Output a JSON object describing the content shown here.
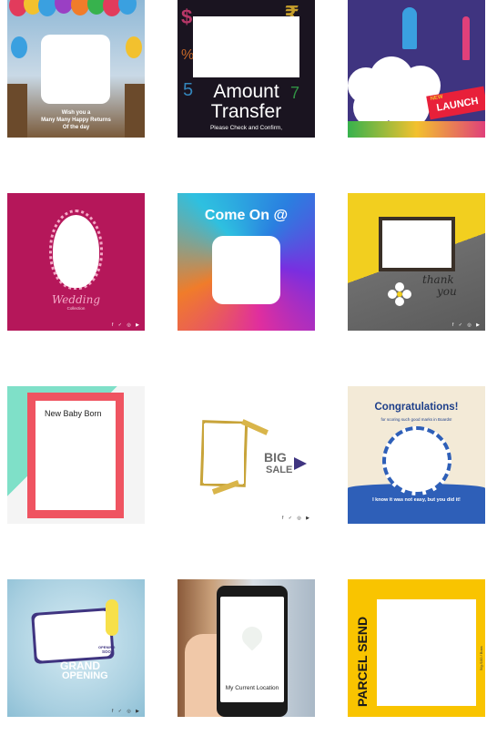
{
  "cards": {
    "birthday": {
      "line1": "Wish you a",
      "line2": "Many Many Happy Returns",
      "line3": "Of the day"
    },
    "transfer": {
      "title1": "Amount",
      "title2": "Transfer",
      "subtitle": "Please Check and Confirm,"
    },
    "launch": {
      "badge_new": "NEW",
      "badge_launch": "LAUNCH"
    },
    "wedding": {
      "script": "Wedding",
      "sub": "Collection"
    },
    "comeon": {
      "title": "Come On @"
    },
    "thankyou": {
      "line1": "thank",
      "line2": "you"
    },
    "baby": {
      "label": "New Baby Born"
    },
    "bigsale": {
      "big": "BIG",
      "sale": "SALE"
    },
    "congrats": {
      "title": "Congratulations!",
      "sub": "for scoring such good marks in Boards!",
      "footer": "I know it was not easy, but you did it!"
    },
    "grand": {
      "grand": "GRAND",
      "opening": "OPENING",
      "tag1": "OPENING",
      "tag2": "SOON"
    },
    "location": {
      "label": "My Current Location"
    },
    "parcel": {
      "title": "PARCEL SEND",
      "side": "5/g /100 / Boxs"
    }
  },
  "colors": {
    "launch_bg": "#3f3480",
    "wedding_bg": "#b5175a",
    "thank_yellow": "#f2cf1f",
    "baby_mint": "#7fe0c8",
    "baby_frame": "#ef5461",
    "congrats_blue": "#2e5fb8",
    "grand_bg": "#a8cfe0",
    "parcel_yellow": "#f9c400"
  },
  "social_icons": "f ✓ ◎ ▶"
}
